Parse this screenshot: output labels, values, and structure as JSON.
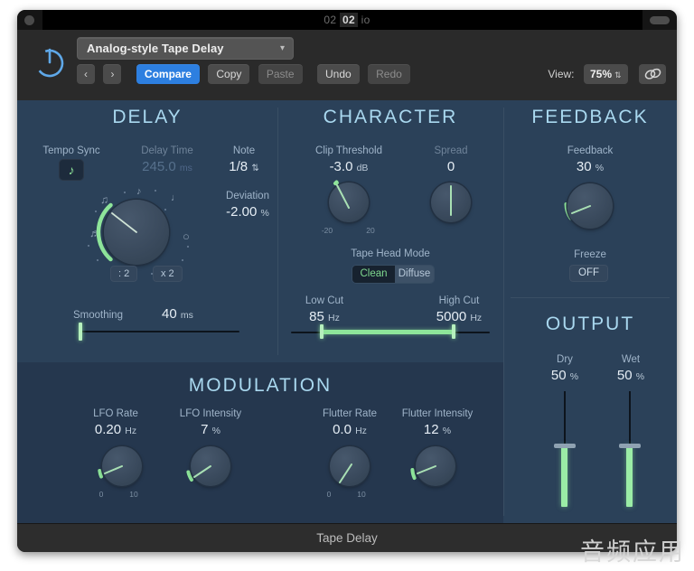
{
  "window": {
    "title_faint_left": "02",
    "title_strong": "02",
    "title_faint_right": "io",
    "footer_title": "Tape Delay",
    "watermark": "音频应用"
  },
  "toolbar": {
    "power_icon": "power-icon",
    "preset_name": "Analog-style Tape Delay",
    "preset_chevron": "▾",
    "prev_label": "‹",
    "next_label": "›",
    "compare_label": "Compare",
    "copy_label": "Copy",
    "paste_label": "Paste",
    "undo_label": "Undo",
    "redo_label": "Redo",
    "view_label": "View:",
    "view_value": "75%",
    "view_stepper": "⇅",
    "link_icon": "link-icon"
  },
  "delay": {
    "title": "DELAY",
    "tempo_sync_label": "Tempo Sync",
    "tempo_sync_icon": "eighth-note-icon",
    "delay_time_label": "Delay Time",
    "delay_time_value": "245.0",
    "delay_time_unit": "ms",
    "note_label": "Note",
    "note_value": "1/8",
    "note_stepper": "⇅",
    "deviation_label": "Deviation",
    "deviation_value": "-2.00",
    "deviation_unit": "%",
    "halve_label": ": 2",
    "double_label": "x 2",
    "smoothing_label": "Smoothing",
    "smoothing_value": "40",
    "smoothing_unit": "ms"
  },
  "character": {
    "title": "CHARACTER",
    "clip_threshold_label": "Clip Threshold",
    "clip_threshold_value": "-3.0",
    "clip_threshold_unit": "dB",
    "clip_tick_min": "-20",
    "clip_tick_max": "20",
    "spread_label": "Spread",
    "spread_value": "0",
    "tape_head_mode_label": "Tape Head Mode",
    "mode_clean": "Clean",
    "mode_diffuse": "Diffuse",
    "mode_selected": "Clean",
    "low_cut_label": "Low Cut",
    "low_cut_value": "85",
    "low_cut_unit": "Hz",
    "high_cut_label": "High Cut",
    "high_cut_value": "5000",
    "high_cut_unit": "Hz"
  },
  "feedback": {
    "title": "FEEDBACK",
    "feedback_label": "Feedback",
    "feedback_value": "30",
    "feedback_unit": "%",
    "freeze_label": "Freeze",
    "freeze_value": "OFF"
  },
  "output": {
    "title": "OUTPUT",
    "dry_label": "Dry",
    "dry_value": "50",
    "dry_unit": "%",
    "wet_label": "Wet",
    "wet_value": "50",
    "wet_unit": "%"
  },
  "modulation": {
    "title": "MODULATION",
    "lfo_rate_label": "LFO Rate",
    "lfo_rate_value": "0.20",
    "lfo_rate_unit": "Hz",
    "lfo_rate_tick_min": "0",
    "lfo_rate_tick_max": "10",
    "lfo_intensity_label": "LFO Intensity",
    "lfo_intensity_value": "7",
    "lfo_intensity_unit": "%",
    "flutter_rate_label": "Flutter Rate",
    "flutter_rate_value": "0.0",
    "flutter_rate_unit": "Hz",
    "flutter_rate_tick_min": "0",
    "flutter_rate_tick_max": "10",
    "flutter_intensity_label": "Flutter Intensity",
    "flutter_intensity_value": "12",
    "flutter_intensity_unit": "%"
  },
  "colors": {
    "accent_green": "#8ee59a",
    "panel_bg": "#2b4159",
    "mod_bg": "#25374e",
    "title_blue": "#a9d8ef",
    "compare_blue": "#2d7fe0"
  }
}
